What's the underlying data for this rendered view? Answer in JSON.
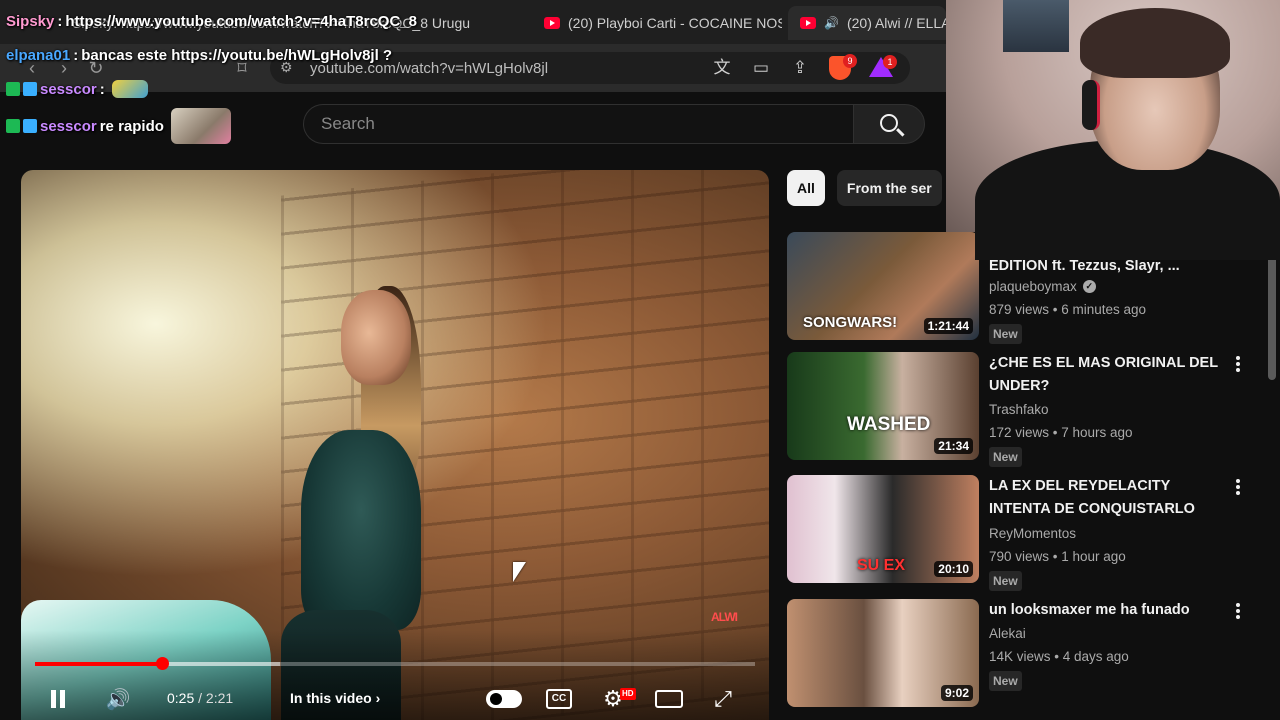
{
  "browser": {
    "tabs": [
      {
        "label": "Sipsky: https://www.youtube.com/watch?v=4haT8rcQC_8 Urugu",
        "active": false
      },
      {
        "label": "(20) Playboi Carti - COCAINE NOS",
        "active": false
      },
      {
        "label": "(20) Alwi // ELLA",
        "active": true
      }
    ],
    "url": "youtube.com/watch?v=hWLgHolv8jl",
    "rewards_badge": "1",
    "brave_badge": "9"
  },
  "youtube": {
    "search_placeholder": "Search",
    "player": {
      "current_time": "0:25",
      "separator": " / ",
      "duration": "2:21",
      "chapter_label": "In this video",
      "progress_fraction": 0.177,
      "buffered_fraction": 0.34,
      "hd_label": "HD",
      "cc_label": "CC",
      "watermark": "ALWI"
    },
    "chips": [
      "All",
      "From the ser"
    ],
    "recommendations": [
      {
        "title": "SONG WARS: RISING STARS EDITION ft. Tezzus, Slayr, ...",
        "channel": "plaqueboymax",
        "verified": true,
        "meta": "879 views • 6 minutes ago",
        "badge": "New",
        "duration": "1:21:44",
        "thumb_text": "SONGWARS!"
      },
      {
        "title": "¿CHE ES EL MAS ORIGINAL DEL UNDER?",
        "channel": "Trashfako",
        "verified": false,
        "meta": "172 views • 7 hours ago",
        "badge": "New",
        "duration": "21:34",
        "thumb_text": "WASHED"
      },
      {
        "title": "LA EX DEL REYDELACITY INTENTA DE CONQUISTARLO",
        "channel": "ReyMomentos",
        "verified": false,
        "meta": "790 views • 1 hour ago",
        "badge": "New",
        "duration": "20:10",
        "thumb_text": "SU EX"
      },
      {
        "title": "un looksmaxer me ha funado",
        "channel": "Alekai",
        "verified": false,
        "meta": "14K views • 4 days ago",
        "badge": "New",
        "duration": "9:02",
        "thumb_text": ""
      }
    ]
  },
  "chat": {
    "lines": [
      {
        "user": "Sipsky",
        "text": "https://www.youtube.com/watch?v=4haT8rcQC_8"
      },
      {
        "user": "elpana01",
        "text": "bancas este https://youtu.be/hWLgHolv8jl ?"
      },
      {
        "user": "sesscor",
        "text": ""
      },
      {
        "user": "sesscor",
        "text": "re rapido"
      }
    ]
  },
  "colors": {
    "background": "#0f0f0f",
    "accent_red": "#ff0000",
    "text_primary": "#f1f1f1",
    "text_secondary": "#aaaaaa"
  }
}
